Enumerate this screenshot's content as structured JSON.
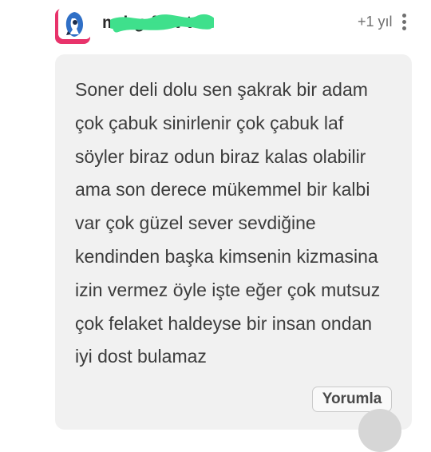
{
  "comment": {
    "author": "m   i  g  f      t t t",
    "time_ago": "+1 yıl",
    "icons": {
      "avatar": "avatar-icon",
      "more": "more-vertical-icon"
    },
    "lines": [
      "Soner deli dolu sen şakrak bir adam",
      "çok çabuk sinirlenir çok çabuk laf",
      "söyler biraz odun biraz kalas olabilir",
      "ama son derece mükemmel bir kalbi",
      "var çok güzel sever sevdiğine",
      "kendinden başka kimsenin kizmasina",
      "izin vermez öyle işte eğer çok mutsuz",
      "çok felaket haldeyse bir insan ondan",
      "iyi dost bulamaz"
    ],
    "reply_label": "Yorumla"
  },
  "colors": {
    "avatar_ring": "#e8336b",
    "avatar_blue": "#2f6fc6",
    "scribble_green": "#3fe08c",
    "bubble_bg": "#f1f1f1"
  }
}
